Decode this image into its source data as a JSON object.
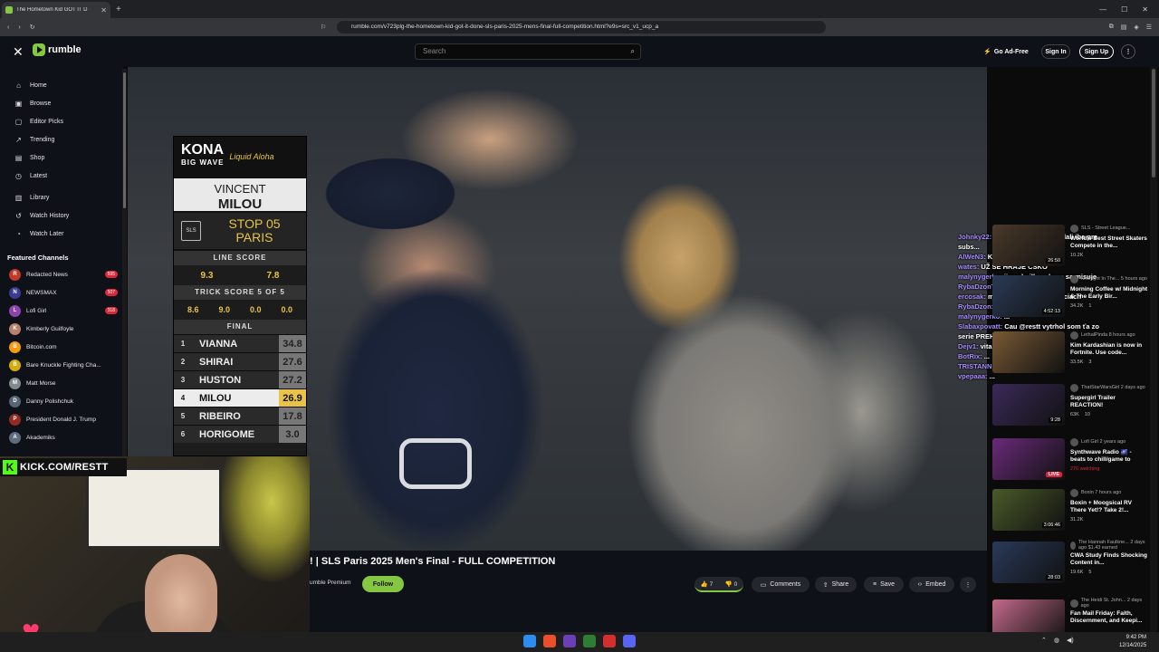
{
  "browser": {
    "tab_title": "The Hometown Kid GOT IT D",
    "url": "rumble.com/v723plg-the-hometown-kid-got-it-done-sls-paris-2025-mens-final-full-competition.html?e9s=src_v1_ucp_a"
  },
  "header": {
    "logo": "rumble",
    "search_placeholder": "Search",
    "go_ad_free": "Go Ad-Free",
    "sign_in": "Sign In",
    "sign_up": "Sign Up"
  },
  "sidebar": {
    "nav": [
      {
        "label": "Home",
        "icon": "home-icon"
      },
      {
        "label": "Browse",
        "icon": "browse-icon"
      },
      {
        "label": "Editor Picks",
        "icon": "editor-picks-icon"
      },
      {
        "label": "Trending",
        "icon": "trending-icon"
      },
      {
        "label": "Shop",
        "icon": "shop-icon"
      },
      {
        "label": "Latest",
        "icon": "latest-icon"
      }
    ],
    "library": [
      {
        "label": "Library",
        "icon": "library-icon"
      },
      {
        "label": "Watch History",
        "icon": "history-icon"
      },
      {
        "label": "Watch Later",
        "icon": "clock-icon"
      }
    ],
    "featured_title": "Featured Channels",
    "channels": [
      {
        "name": "Redacted News",
        "badge": "595",
        "color": "#c0392b",
        "initial": "R"
      },
      {
        "name": "NEWSMAX",
        "badge": "507",
        "color": "#3b3b8f",
        "initial": "N"
      },
      {
        "name": "Lofi Girl",
        "badge": "318",
        "color": "#8e44ad",
        "initial": "L"
      },
      {
        "name": "Kimberly Guilfoyle",
        "badge": "",
        "color": "#b5836d",
        "initial": "K"
      },
      {
        "name": "Bitcoin.com",
        "badge": "",
        "color": "#f39c12",
        "initial": "B"
      },
      {
        "name": "Bare Knuckle Fighting Cha...",
        "badge": "",
        "color": "#d4ac0d",
        "initial": "B"
      },
      {
        "name": "Matt Morse",
        "badge": "",
        "color": "#7f8c8d",
        "initial": "M"
      },
      {
        "name": "Danny Polishchuk",
        "badge": "",
        "color": "#566573",
        "initial": "D"
      },
      {
        "name": "President Donald J. Trump",
        "badge": "",
        "color": "#922b21",
        "initial": "P"
      },
      {
        "name": "Akademiks",
        "badge": "",
        "color": "#5d6d7e",
        "initial": "A"
      }
    ]
  },
  "scoreboard": {
    "brand": "KONA",
    "brand_sub": "BIG WAVE",
    "brand_tag": "Liquid Aloha",
    "skater_first": "VINCENT",
    "skater_last": "MILOU",
    "stop_line1": "STOP 05",
    "stop_line2": "PARIS",
    "sls": "SLS",
    "line_score_label": "LINE SCORE",
    "line_scores": [
      "9.3",
      "7.8"
    ],
    "trick_score_label": "TRICK SCORE 5 OF 5",
    "trick_scores": [
      "8.6",
      "9.0",
      "0.0",
      "0.0"
    ],
    "final_label": "FINAL",
    "standings": [
      {
        "rank": "1",
        "name": "VIANNA",
        "score": "34.8"
      },
      {
        "rank": "2",
        "name": "SHIRAI",
        "score": "27.6"
      },
      {
        "rank": "3",
        "name": "HUSTON",
        "score": "27.2"
      },
      {
        "rank": "4",
        "name": "MILOU",
        "score": "26.9"
      },
      {
        "rank": "5",
        "name": "RIBEIRO",
        "score": "17.8"
      },
      {
        "rank": "6",
        "name": "HORIGOME",
        "score": "3.0"
      }
    ]
  },
  "webcam": {
    "kick_label": "KICK.COM/RESTT"
  },
  "video": {
    "title": "! | SLS Paris 2025 Men's Final - FULL COMPETITION",
    "channel_fragment": "umble Premium",
    "follow": "Follow",
    "upvotes": "7",
    "downvotes": "0",
    "comments": "Comments",
    "share": "Share",
    "save": "Save",
    "embed": "Embed"
  },
  "chat": [
    {
      "user": "Johnky22:",
      "text": " @malynygerko už to dali iba pre subs..."
    },
    {
      "user": "AlWeN3:",
      "text": " KKona"
    },
    {
      "user": "wates:",
      "text": " UŽ SE HRAJE CSKO"
    },
    {
      "user": "malynygerko:",
      "text": " ji nachvilku, ale uz sa misuje"
    },
    {
      "user": "RybaDzonTV:",
      "text": " ..."
    },
    {
      "user": "ercosak:",
      "text": " ma byt 2026 v michalovciach"
    },
    {
      "user": "RybaDzon:",
      "text": " ..."
    },
    {
      "user": "malynygerko:",
      "text": " ..."
    },
    {
      "user": "Slabaxpovatt:",
      "text": " Cau @restt vytrhol som ťa zo serie PREHIER?"
    },
    {
      "user": "Dejv1:",
      "text": " vitality 7:0"
    },
    {
      "user": "BotRix:",
      "text": " ..."
    },
    {
      "user": "TRISTANN:",
      "text": " ..."
    },
    {
      "user": "vpepaaa:",
      "text": " ..."
    }
  ],
  "recommendations": [
    {
      "channel": "SLS - Street League...",
      "title": "World's Best Street Skaters Compete in the...",
      "duration": "26:50",
      "views": "10.2K",
      "comments": "",
      "thumb": "#4a3a2a",
      "live": false,
      "watching": ""
    },
    {
      "channel": "Midnight In The... 5 hours ago",
      "title": "Morning Coffee w/ Midnight & The Early Bir...",
      "duration": "4:52:13",
      "views": "34.2K",
      "comments": "1",
      "thumb": "#2a3a55",
      "live": false,
      "watching": ""
    },
    {
      "channel": "LethalPinda 8 hours ago",
      "title": "Kim Kardashian is now in Fortnite. Use code...",
      "duration": "",
      "views": "33.5K",
      "comments": "3",
      "thumb": "#7a5a35",
      "live": false,
      "watching": ""
    },
    {
      "channel": "ThatStarWarsGirl 2 days ago",
      "title": "Supergirl Trailer REACTION!",
      "duration": "9:28",
      "views": "63K",
      "comments": "10",
      "thumb": "#3a2a5a",
      "live": false,
      "watching": ""
    },
    {
      "channel": "Lofi Girl 2 years ago",
      "title": "Synthwave Radio 🌌 - beats to chill/game to",
      "duration": "",
      "views": "",
      "comments": "",
      "thumb": "#6a2a7a",
      "live": true,
      "watching": "270 watching"
    },
    {
      "channel": "Boxin 7 hours ago",
      "title": "Boxin + Moogsical RV There Yet!? Take 2!...",
      "duration": "3:06:46",
      "views": "31.2K",
      "comments": "",
      "thumb": "#4a5a2a",
      "live": false,
      "watching": ""
    },
    {
      "channel": "The Hannah Faulkne... 2 days ago $1.43 earned",
      "title": "CWA Study Finds Shocking Content in...",
      "duration": "28:03",
      "views": "19.6K",
      "comments": "5",
      "thumb": "#2a3a5a",
      "live": false,
      "watching": ""
    },
    {
      "channel": "The Heidi St. John... 2 days ago",
      "title": "Fan Mail Friday: Faith, Discernment, and Keepi...",
      "duration": "",
      "views": "",
      "comments": "",
      "thumb": "#c46a8a",
      "live": false,
      "watching": ""
    }
  ],
  "taskbar": {
    "time": "9:42 PM",
    "date": "12/14/2025"
  }
}
